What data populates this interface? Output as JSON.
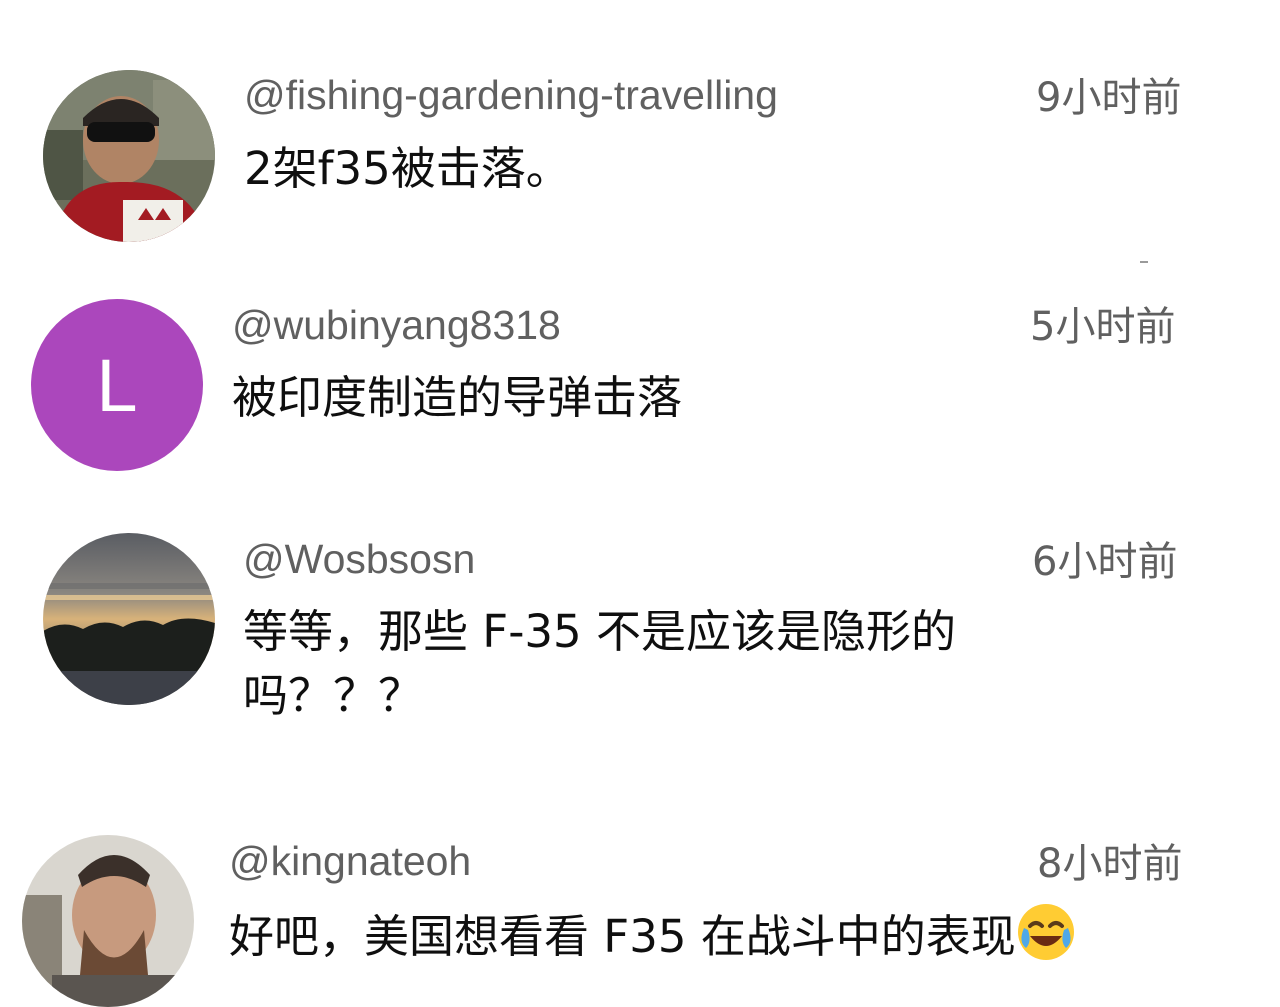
{
  "comments": [
    {
      "handle": "@fishing-gardening-travelling",
      "time": "9小时前",
      "text": "2架f35被击落。",
      "avatar_type": "photo-person-sunglasses"
    },
    {
      "handle": "@wubinyang8318",
      "time": "5小时前",
      "text": "被印度制造的导弹击落",
      "avatar_type": "letter",
      "avatar_letter": "L",
      "avatar_color": "#ab47bc"
    },
    {
      "handle": "@Wosbsosn",
      "time": "6小时前",
      "text_line1": "等等，那些 F-35 不是应该是隐形的",
      "text_line2": "吗？？？",
      "avatar_type": "photo-sunset"
    },
    {
      "handle": "@kingnateoh",
      "time": "8小时前",
      "text": "好吧，美国想看看 F35 在战斗中的表现",
      "emoji": "face-with-tears-of-joy",
      "avatar_type": "photo-bearded-man"
    }
  ],
  "colors": {
    "handle": "#606060",
    "text": "#0f0f0f",
    "background": "#ffffff"
  }
}
